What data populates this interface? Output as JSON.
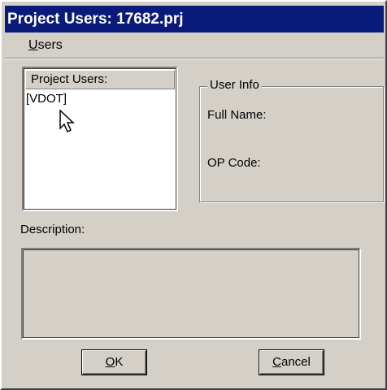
{
  "window": {
    "title": "Project Users: 17682.prj"
  },
  "menu": {
    "users_mnemonic": "U",
    "users_rest": "sers"
  },
  "project_users": {
    "header": "Project Users:",
    "items": [
      "[VDOT]"
    ]
  },
  "user_info": {
    "legend": "User Info",
    "full_name_label": "Full Name:",
    "op_code_label": "OP Code:"
  },
  "description": {
    "label": "Description:"
  },
  "buttons": {
    "ok_mnemonic": "O",
    "ok_rest": "K",
    "cancel_mnemonic": "C",
    "cancel_rest": "ancel"
  },
  "icons": {
    "cursor": "mouse-pointer-icon"
  },
  "colors": {
    "titlebar": "#0a1a7a",
    "face": "#d4d0c8"
  }
}
